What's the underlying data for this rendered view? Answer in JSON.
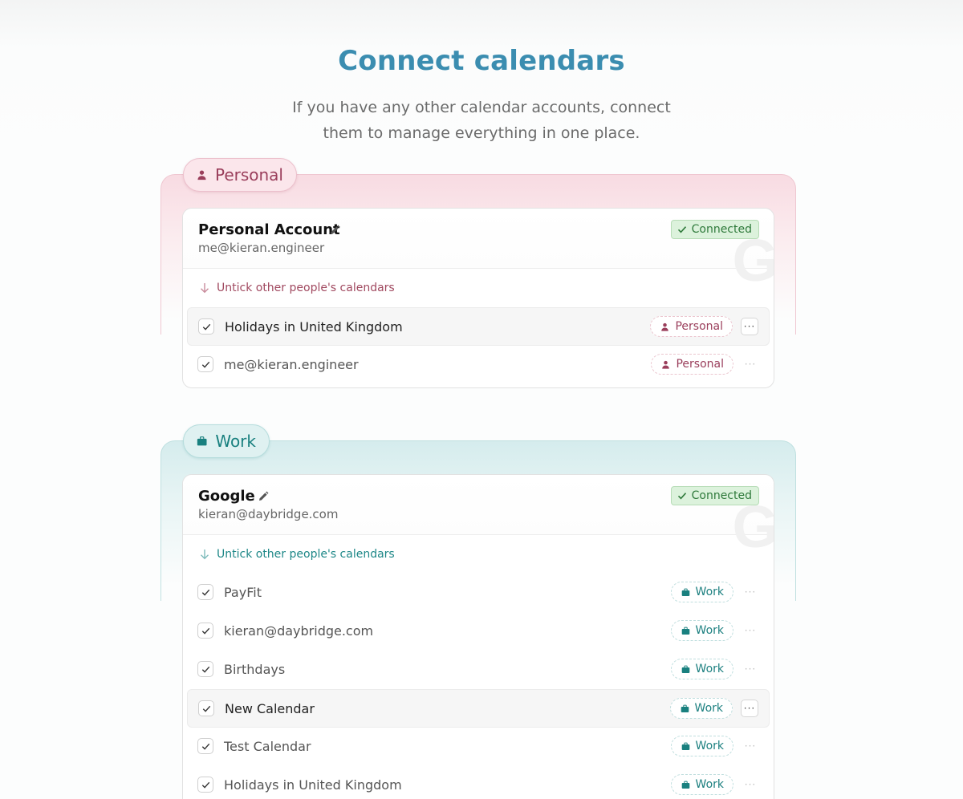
{
  "header": {
    "title": "Connect calendars",
    "subtitle_line1": "If you have any other calendar accounts, connect",
    "subtitle_line2": "them to manage everything in one place."
  },
  "colors": {
    "title": "#3b8db0",
    "personal_accent": "#9a3e5b",
    "work_accent": "#19807f",
    "connected_green": "#2f7a3b"
  },
  "groups": [
    {
      "label": "Personal",
      "icon": "person-icon",
      "account": {
        "name": "Personal Account",
        "email": "me@kieran.engineer",
        "status": "Connected",
        "watermark": "G"
      },
      "untick_label": "Untick other people's calendars",
      "calendars": [
        {
          "name": "Holidays in United Kingdom",
          "tag": "Personal",
          "checked": true,
          "more": "···"
        },
        {
          "name": "me@kieran.engineer",
          "tag": "Personal",
          "checked": true,
          "more": "···"
        }
      ]
    },
    {
      "label": "Work",
      "icon": "briefcase-icon",
      "account": {
        "name": "Google",
        "email": "kieran@daybridge.com",
        "status": "Connected",
        "watermark": "G"
      },
      "untick_label": "Untick other people's calendars",
      "calendars": [
        {
          "name": "PayFit",
          "tag": "Work",
          "checked": true,
          "more": "···"
        },
        {
          "name": "kieran@daybridge.com",
          "tag": "Work",
          "checked": true,
          "more": "···"
        },
        {
          "name": "Birthdays",
          "tag": "Work",
          "checked": true,
          "more": "···"
        },
        {
          "name": "New Calendar",
          "tag": "Work",
          "checked": true,
          "more": "···"
        },
        {
          "name": "Test Calendar",
          "tag": "Work",
          "checked": true,
          "more": "···"
        },
        {
          "name": "Holidays in United Kingdom",
          "tag": "Work",
          "checked": true,
          "more": "···"
        }
      ]
    }
  ]
}
